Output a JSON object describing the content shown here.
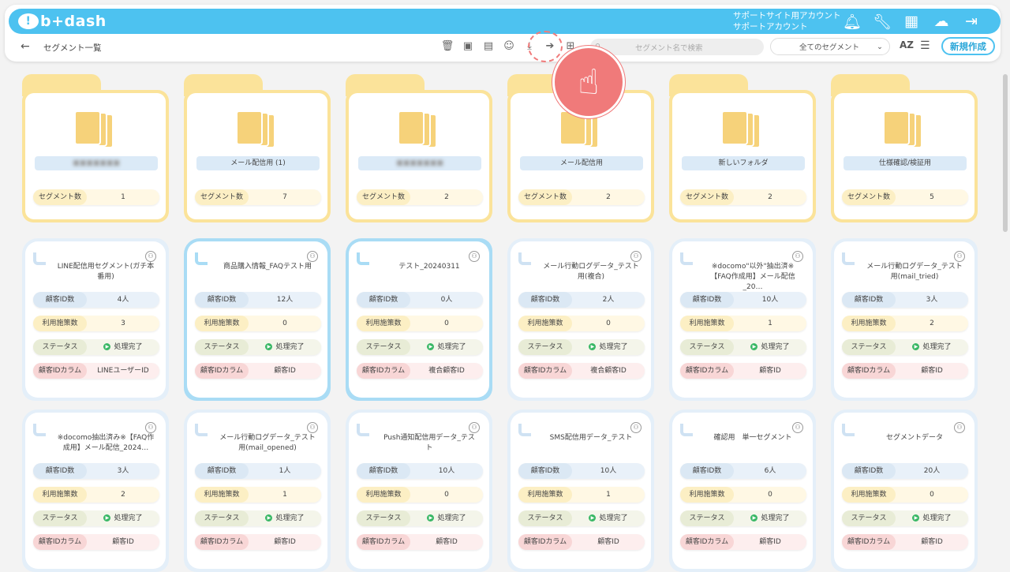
{
  "app": {
    "logo": "b+dash"
  },
  "account": {
    "line1": "サポートサイト用アカウント",
    "line2": "サポートアカウント"
  },
  "toolbar": {
    "breadcrumb": "セグメント一覧",
    "search_placeholder": "セグメント名で検索",
    "filter_value": "全てのセグメント",
    "sort_label": "AZ",
    "new_label": "新規作成"
  },
  "icons": {
    "top": [
      "bell-icon",
      "wrench-icon",
      "grid-icon",
      "chat-icon",
      "logout-icon"
    ],
    "tools": [
      "trash-icon",
      "archive-icon",
      "unarchive-icon",
      "user-check-icon",
      "download-icon",
      "move-to-folder-icon",
      "add-folder-icon"
    ]
  },
  "folders": [
    {
      "name": "",
      "blurred": true,
      "count_label": "セグメント数",
      "count": "1"
    },
    {
      "name": "メール配信用 (1)",
      "blurred": false,
      "count_label": "セグメント数",
      "count": "7"
    },
    {
      "name": "",
      "blurred": true,
      "count_label": "セグメント数",
      "count": "2"
    },
    {
      "name": "メール配信用",
      "blurred": false,
      "count_label": "セグメント数",
      "count": "2"
    },
    {
      "name": "新しいフォルダ",
      "blurred": false,
      "count_label": "セグメント数",
      "count": "2"
    },
    {
      "name": "仕様確認/検証用",
      "blurred": false,
      "count_label": "セグメント数",
      "count": "5"
    }
  ],
  "labels": {
    "customers": "顧客ID数",
    "measures": "利用施策数",
    "status": "ステータス",
    "column": "顧客IDカラム"
  },
  "segments": [
    {
      "title": "LINE配信用セグメント(ガチ本番用)",
      "customers": "4人",
      "measures": "3",
      "status": "処理完了",
      "column": "LINEユーザーID",
      "selected": false
    },
    {
      "title": "商品購入情報_FAQテスト用",
      "customers": "12人",
      "measures": "0",
      "status": "処理完了",
      "column": "顧客ID",
      "selected": true
    },
    {
      "title": "テスト_20240311",
      "customers": "0人",
      "measures": "0",
      "status": "処理完了",
      "column": "複合顧客ID",
      "selected": true
    },
    {
      "title": "メール行動ログデータ_テスト用(複合)",
      "customers": "2人",
      "measures": "0",
      "status": "処理完了",
      "column": "複合顧客ID",
      "selected": false
    },
    {
      "title": "※docomo\"以外\"抽出済※【FAQ作成用】メール配信_20…",
      "customers": "10人",
      "measures": "1",
      "status": "処理完了",
      "column": "顧客ID",
      "selected": false
    },
    {
      "title": "メール行動ログデータ_テスト用(mail_tried)",
      "customers": "3人",
      "measures": "2",
      "status": "処理完了",
      "column": "顧客ID",
      "selected": false
    },
    {
      "title": "※docomo抽出済み※【FAQ作成用】メール配信_2024…",
      "customers": "3人",
      "measures": "2",
      "status": "処理完了",
      "column": "顧客ID",
      "selected": false
    },
    {
      "title": "メール行動ログデータ_テスト用(mail_opened)",
      "customers": "1人",
      "measures": "1",
      "status": "処理完了",
      "column": "顧客ID",
      "selected": false
    },
    {
      "title": "Push通知配信用データ_テスト",
      "customers": "10人",
      "measures": "0",
      "status": "処理完了",
      "column": "顧客ID",
      "selected": false
    },
    {
      "title": "SMS配信用データ_テスト",
      "customers": "10人",
      "measures": "1",
      "status": "処理完了",
      "column": "顧客ID",
      "selected": false
    },
    {
      "title": "確認用　単一セグメント",
      "customers": "6人",
      "measures": "0",
      "status": "処理完了",
      "column": "顧客ID",
      "selected": false
    },
    {
      "title": "セグメントデータ",
      "customers": "20人",
      "measures": "0",
      "status": "処理完了",
      "column": "顧客ID",
      "selected": false
    }
  ]
}
